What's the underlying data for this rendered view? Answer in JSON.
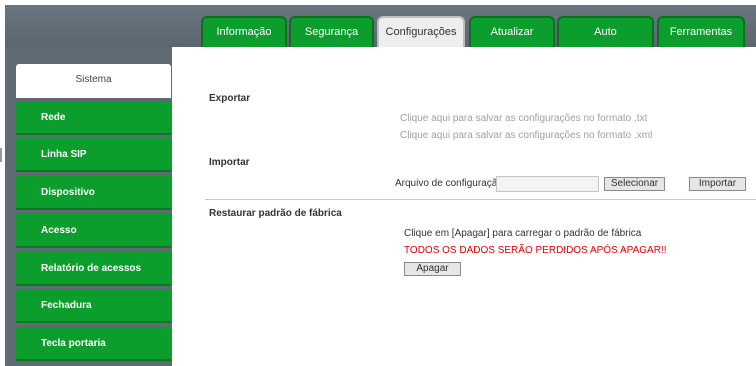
{
  "tabs": [
    {
      "label": "Informação",
      "active": false
    },
    {
      "label": "Segurança",
      "active": false
    },
    {
      "label": "Configurações",
      "active": true
    },
    {
      "label": "Atualizar",
      "active": false
    },
    {
      "label": "Auto provisionamento",
      "active": false
    },
    {
      "label": "Ferramentas",
      "active": false
    }
  ],
  "sidebar": {
    "items": [
      {
        "label": "Sistema",
        "active": true
      },
      {
        "label": "Rede"
      },
      {
        "label": "Linha SIP"
      },
      {
        "label": "Dispositivo"
      },
      {
        "label": "Acesso"
      },
      {
        "label": "Relatório de acessos"
      },
      {
        "label": "Fechadura"
      },
      {
        "label": "Tecla portaria"
      }
    ]
  },
  "main": {
    "export": {
      "title": "Exportar",
      "link_txt": "Clique aqui para salvar as configurações no formato .txt",
      "link_xml": "Clique aqui para salvar as configurações no formato .xml"
    },
    "import": {
      "title": "Importar",
      "file_label": "Arquivo de configuração:",
      "file_value": "",
      "select_label": "Selecionar",
      "import_label": "Importar"
    },
    "restore": {
      "title": "Restaurar padrão de fábrica",
      "instruction": "Clique em [Apagar] para carregar o padrão de fábrica",
      "warning": "TODOS OS DADOS SERÃO PERDIDOS APÓS APAGAR!!",
      "erase_label": "Apagar"
    }
  },
  "colors": {
    "accent_green": "#0b9e2c",
    "header_gray": "#5c6670",
    "warning_red": "#e00000"
  }
}
